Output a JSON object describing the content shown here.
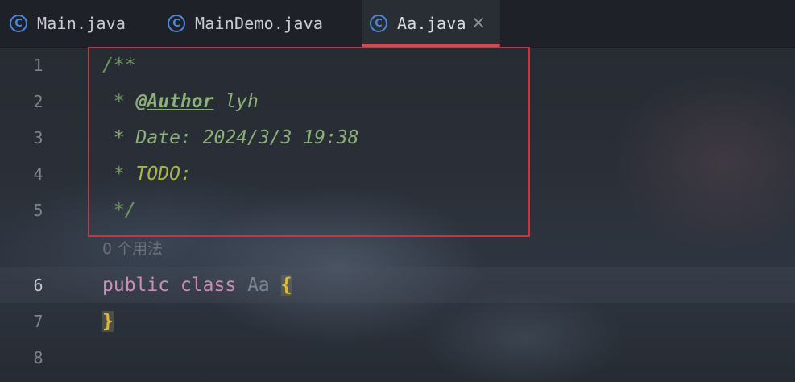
{
  "tabs": [
    {
      "label": "Main.java",
      "icon": "class-icon",
      "active": false
    },
    {
      "label": "MainDemo.java",
      "icon": "class-icon",
      "active": false
    },
    {
      "label": "Aa.java",
      "icon": "class-icon",
      "active": true,
      "close": "×"
    }
  ],
  "class_icon_glyph": "C",
  "accent_color": "#c0525a",
  "annotation_box_color": "#d3313a",
  "editor": {
    "lines": [
      {
        "number": "1",
        "segments": [
          "/**"
        ]
      },
      {
        "number": "2",
        "segments": [
          " * ",
          "@Author",
          " lyh"
        ]
      },
      {
        "number": "3",
        "segments": [
          " * Date: 2024/3/3 19:38"
        ]
      },
      {
        "number": "4",
        "segments": [
          " * ",
          "TODO:"
        ]
      },
      {
        "number": "5",
        "segments": [
          " */"
        ]
      },
      {
        "number": "6",
        "segments": [
          "public",
          " ",
          "class",
          " ",
          "Aa",
          " ",
          "{"
        ]
      },
      {
        "number": "7",
        "segments": [
          "}"
        ]
      },
      {
        "number": "8",
        "segments": []
      }
    ],
    "usages_hint": "0 个用法"
  }
}
